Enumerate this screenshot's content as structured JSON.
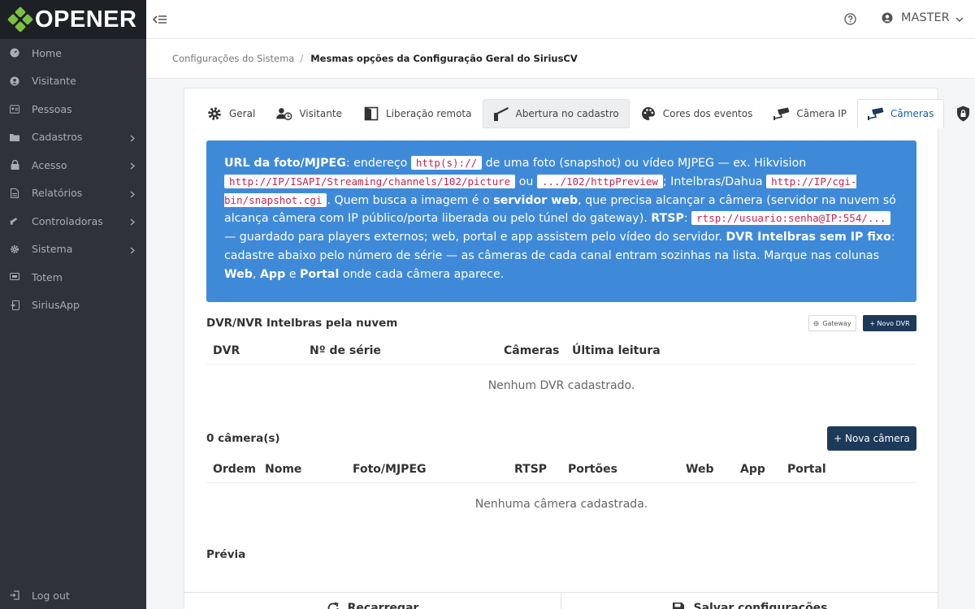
{
  "brand": {
    "name": "OPENER",
    "accent": "#7cc142"
  },
  "sidebar": {
    "items": [
      {
        "label": "Home",
        "icon": "speedometer-icon",
        "chevron": false
      },
      {
        "label": "Visitante",
        "icon": "user-circle-icon",
        "chevron": false
      },
      {
        "label": "Pessoas",
        "icon": "id-card-icon",
        "chevron": false
      },
      {
        "label": "Cadastros",
        "icon": "folder-icon",
        "chevron": true
      },
      {
        "label": "Acesso",
        "icon": "lock-icon",
        "chevron": true
      },
      {
        "label": "Relatórios",
        "icon": "document-icon",
        "chevron": true
      },
      {
        "label": "Controladoras",
        "icon": "controller-icon",
        "chevron": true
      },
      {
        "label": "Sistema",
        "icon": "gear-icon",
        "chevron": true
      },
      {
        "label": "Totem",
        "icon": "totem-icon",
        "chevron": false
      },
      {
        "label": "SiriusApp",
        "icon": "app-icon",
        "chevron": false
      }
    ],
    "logout": "Log out"
  },
  "topbar": {
    "user": "MASTER"
  },
  "breadcrumb": {
    "parent": "Configurações do Sistema",
    "separator": "/",
    "current": "Mesmas opções da Configuração Geral do SiriusCV"
  },
  "tabs": [
    {
      "label": "Geral",
      "icon": "gear-icon",
      "state": "normal"
    },
    {
      "label": "Visitante",
      "icon": "user-clock-icon",
      "state": "normal"
    },
    {
      "label": "Liberação remota",
      "icon": "door-icon",
      "state": "normal"
    },
    {
      "label": "Abertura no cadastro",
      "icon": "barrier-icon",
      "state": "hover"
    },
    {
      "label": "Cores dos eventos",
      "icon": "palette-icon",
      "state": "normal"
    },
    {
      "label": "Câmera IP",
      "icon": "cctv-icon",
      "state": "normal"
    },
    {
      "label": "Câmeras",
      "icon": "cctv-icon",
      "state": "active"
    },
    {
      "label": "",
      "icon": "shield-icon",
      "state": "normal"
    }
  ],
  "info": {
    "t1": "URL da foto/MJPEG",
    "t2": ": endereço ",
    "c1": "http(s)://",
    "t3": " de uma foto (snapshot) ou vídeo MJPEG — ex. Hikvision ",
    "c2": "http://IP/ISAPI/Streaming/channels/102/picture",
    "t4": " ou ",
    "c3": ".../102/httpPreview",
    "t5": "; Intelbras/Dahua ",
    "c4": "http://IP/cgi-bin/snapshot.cgi",
    "t6": ". Quem busca a imagem é o ",
    "t7": "servidor web",
    "t8": ", que precisa alcançar a câmera (servidor na nuvem só alcança câmera com IP público/porta liberada ou pelo túnel do gateway). ",
    "t9": "RTSP",
    "t10": ": ",
    "c5": "rtsp://usuario:senha@IP:554/...",
    "t11": " — guardado para players externos; web, portal e app assistem pelo vídeo do servidor. ",
    "t12": "DVR Intelbras sem IP fixo",
    "t13": ": cadastre abaixo pelo número de série — as câmeras de cada canal entram sozinhas na lista. Marque nas colunas ",
    "t14": "Web",
    "t15": ", ",
    "t16": "App",
    "t17": " e ",
    "t18": "Portal",
    "t19": " onde cada câmera aparece.",
    "bg": "#3f8ad8"
  },
  "dvr": {
    "title": "DVR/NVR Intelbras pela nuvem",
    "gateway_label": "Gateway",
    "new_label": "+ Novo DVR",
    "columns": [
      "DVR",
      "Nº de série",
      "Câmeras",
      "Última leitura"
    ],
    "empty": "Nenhum DVR cadastrado."
  },
  "cameras": {
    "count_label": "0 câmera(s)",
    "new_label": "+ Nova câmera",
    "columns": [
      "Ordem",
      "Nome",
      "Foto/MJPEG",
      "RTSP",
      "Portões",
      "Web",
      "App",
      "Portal"
    ],
    "empty": "Nenhuma câmera cadastrada."
  },
  "preview": {
    "title": "Prévia"
  },
  "footer": {
    "reset_label": "Recarregar",
    "save_label": "Salvar configurações"
  },
  "colors": {
    "sidebar": "#2f3339",
    "primary_button": "#1d3a5b",
    "active_tab": "#1e5fa8"
  }
}
